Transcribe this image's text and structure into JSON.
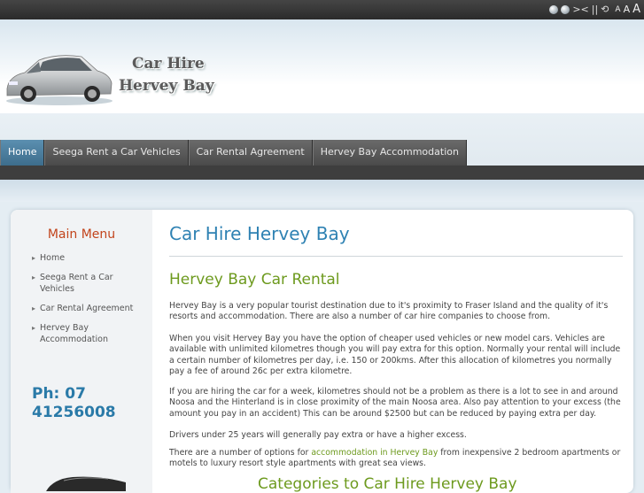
{
  "toolbar": {
    "icons": [
      "globe-icon",
      "globe-icon",
      "shrink-icon",
      "pause-icon",
      "refresh-icon"
    ],
    "icon_glyphs": [
      "><",
      "||",
      "⟲"
    ],
    "font_sizes": [
      "A",
      "A",
      "A"
    ]
  },
  "header": {
    "logo_line1": "Car Hire",
    "logo_line2": "Hervey Bay"
  },
  "nav": {
    "items": [
      "Home",
      "Seega Rent a Car Vehicles",
      "Car Rental Agreement",
      "Hervey Bay Accommodation"
    ],
    "active": "Home"
  },
  "sidebar": {
    "title": "Main Menu",
    "items": [
      "Home",
      "Seega Rent a Car Vehicles",
      "Car Rental Agreement",
      "Hervey Bay Accommodation"
    ],
    "phone_line1": "Ph: 07",
    "phone_line2": "41256008"
  },
  "main": {
    "title": "Car Hire Hervey Bay",
    "subtitle": "Hervey Bay Car Rental",
    "p1": "Hervey Bay is a very popular tourist destination due to it's proximity to Fraser Island and the quality of it's resorts and accommodation. There are also a number of car hire companies to choose from.",
    "p2": "When you visit Hervey Bay you have the option of cheaper used vehicles or new model cars. Vehicles are available with unlimited kilometres though you will pay extra for this option. Normally your rental will include a certain number of kilometres per day, i.e. 150 or 200kms. After this allocation of kilometres you normally pay a fee of around 26c per extra kilometre.",
    "p3": "If you are hiring the car for a week, kilometres should not be a problem as there is a lot to see in and around Noosa and the Hinterland is in close proximity of the main Noosa area. Also pay attention to your excess (the amount you pay in an accident) This can be around $2500 but can be reduced by paying extra per day.",
    "p4": "Drivers under 25 years will generally pay extra or have a higher excess.",
    "p5_before": "There are a number of options for ",
    "p5_link": "accommodation in Hervey Bay",
    "p5_after": " from inexpensive 2 bedroom apartments or motels to luxury resort style apartments with great sea views.",
    "next_heading": "Categories to Car Hire Hervey Bay"
  }
}
